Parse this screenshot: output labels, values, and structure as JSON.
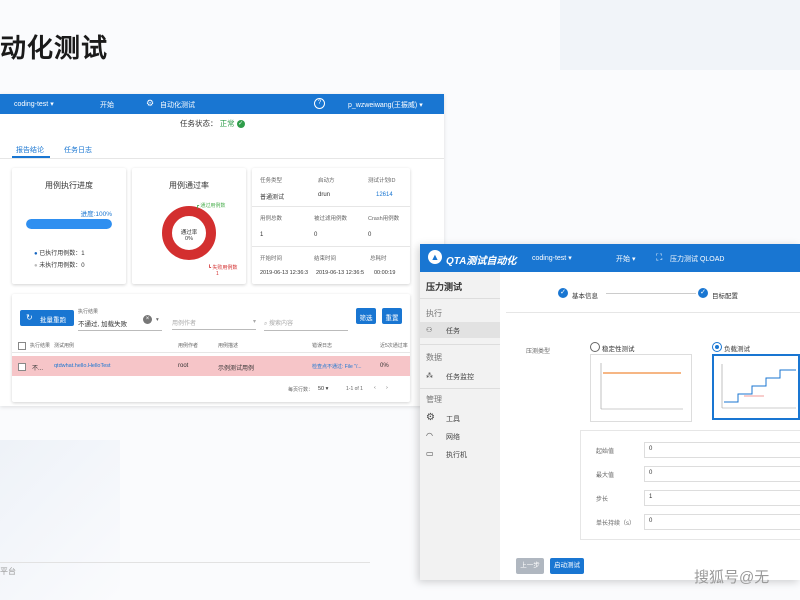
{
  "slide": {
    "title": "动化测试",
    "footer": "平台",
    "watermark": "搜狐号@无"
  },
  "report": {
    "nav": {
      "project": "coding-test",
      "start": "开始",
      "auto_test": "自动化测试",
      "help_icon": "help-icon",
      "user": "p_wzweiwang(王振威)"
    },
    "status_label": "任务状态：",
    "status_value": "正常",
    "tabs": [
      "报告结论",
      "任务日志"
    ],
    "progress_card": {
      "title": "用例执行进度",
      "progress_text": "进度:100%",
      "progress": 1.0,
      "executed": "已执行用例数：1",
      "not_executed": "未执行用例数：0"
    },
    "pass_card": {
      "title": "用例通过率",
      "center_label": "通过率",
      "center_value": "0%",
      "legend_pass": "通过用例数",
      "legend_fail": "失败用例数",
      "fail_count": "1",
      "pass_rate": 0
    },
    "info_card": {
      "rows": [
        {
          "headers": [
            "任务类型",
            "启动方",
            "测试计划ID"
          ],
          "values": [
            "普通测试",
            "drun",
            "12614"
          ]
        },
        {
          "headers": [
            "用例总数",
            "被过滤用例数",
            "Crash用例数"
          ],
          "values": [
            "1",
            "0",
            "0"
          ]
        },
        {
          "headers": [
            "开始时间",
            "结束时间",
            "总耗时"
          ],
          "values": [
            "2019-06-13 12:36:3",
            "2019-06-13 12:36:5",
            "00:00:19"
          ]
        }
      ]
    },
    "toolbar": {
      "batch_btn": "批量重跑",
      "filter_label": "执行结果",
      "filter_value": "不通过, 加载失败",
      "author_placeholder": "用例作者",
      "search_placeholder": "搜索内容",
      "filter_btn": "筛选",
      "reset_btn": "重置"
    },
    "table": {
      "headers": [
        "执行结果",
        "测试用例",
        "用例作者",
        "用例描述",
        "错误日志",
        "近5次通过率"
      ],
      "rows": [
        {
          "result": "不...",
          "case": "qtdwhat.hello.HelloTest",
          "author": "root",
          "desc": "示例测试用例",
          "log": "检查点不通过: File \"/...",
          "rate": "0%"
        }
      ]
    },
    "pagination": {
      "per_page_label": "每页行数：",
      "per_page": "50",
      "range": "1-1 of 1"
    }
  },
  "qta": {
    "nav": {
      "logo": "QTA测试自动化",
      "project": "coding-test",
      "start": "开始",
      "page": "压力测试 QLOAD"
    },
    "sidebar": {
      "title": "压力测试",
      "sections": [
        {
          "label": "执行",
          "items": [
            {
              "label": "任务",
              "icon": "task-icon"
            }
          ]
        },
        {
          "label": "数据",
          "items": [
            {
              "label": "任务监控",
              "icon": "monitor-icon"
            }
          ]
        },
        {
          "label": "管理",
          "items": [
            {
              "label": "工具",
              "icon": "gear-icon"
            },
            {
              "label": "网络",
              "icon": "wifi-icon"
            },
            {
              "label": "执行机",
              "icon": "laptop-icon"
            }
          ]
        }
      ]
    },
    "steps": [
      "基本信息",
      "目标配置"
    ],
    "test_type_label": "压测类型",
    "options": [
      {
        "label": "稳定性测试",
        "selected": false
      },
      {
        "label": "负载测试",
        "selected": true
      }
    ],
    "fields": [
      {
        "label": "起始值",
        "value": "0"
      },
      {
        "label": "最大值",
        "value": "0"
      },
      {
        "label": "步长",
        "value": "1"
      },
      {
        "label": "单长持续（s）",
        "value": "0"
      }
    ],
    "prev_btn": "上一步",
    "start_btn": "启动测试"
  }
}
